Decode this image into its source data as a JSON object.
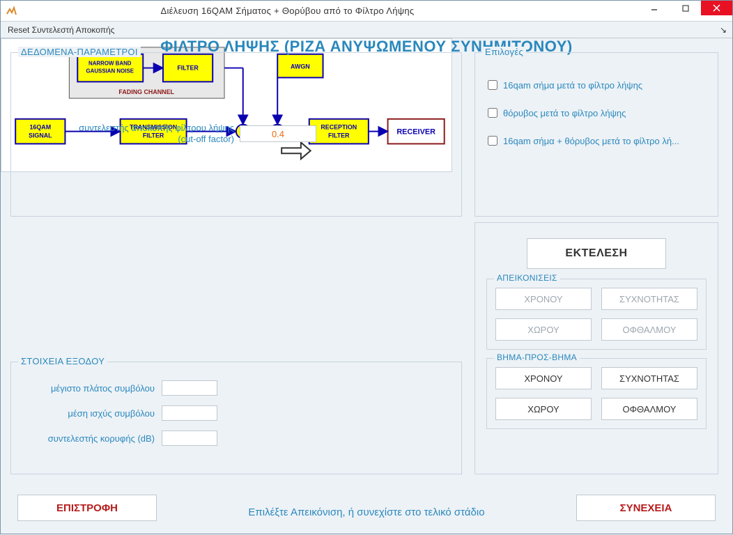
{
  "window": {
    "title": "Διέλευση 16QAM Σήματος + Θορύβου από το Φίλτρο Λήψης"
  },
  "menubar": {
    "reset": "Reset Συντελεστή Αποκοπής"
  },
  "main_title": "ΦΙΛΤΡΟ ΛΗΨΗΣ (ΡΙΖΑ ΑΝΥΨΩΜΕΝΟΥ ΣΥΝΗΜΙΤΟΝΟΥ)",
  "params": {
    "legend": "ΔΕΔΟΜΕΝΑ-ΠΑΡΑΜΕΤΡΟΙ",
    "cutoff_label_line1": "συντελεστής αποκοπής φίλτρου λήψης",
    "cutoff_label_line2": "(cut-off factor)",
    "cutoff_value": "0.4"
  },
  "options": {
    "legend": "Επιλογές",
    "items": [
      "16qam σήμα μετά το φίλτρο λήψης",
      "θόρυβος μετά το φίλτρο λήψης",
      "16qam σήμα + θόρυβος μετά το φίλτρο λή..."
    ]
  },
  "diagram": {
    "blocks": {
      "nbg_noise_l1": "NARROW BAND",
      "nbg_noise_l2": "GAUSSIAN NOISE",
      "filter": "FILTER",
      "fading_label": "FADING CHANNEL",
      "awgn": "AWGN",
      "qam_l1": "16QAM",
      "qam_l2": "SIGNAL",
      "tx_l1": "TRANSMISSION",
      "tx_l2": "FILTER",
      "rx_l1": "RECEPTION",
      "rx_l2": "FILTER",
      "receiver": "RECEIVER",
      "mult": "x",
      "adder": "+"
    }
  },
  "outputs": {
    "legend": "ΣΤΟΙΧΕΙΑ ΕΞΟΔΟΥ",
    "rows": [
      "μέγιστο πλάτος συμβόλου",
      "μέση ισχύς συμβόλου",
      "συντελεστής κορυφής (dB)"
    ]
  },
  "actions": {
    "execute": "ΕΚΤΕΛΕΣΗ",
    "views": {
      "legend": "ΑΠΕΙΚΟΝΙΣΕΙΣ",
      "btns": [
        "ΧΡΟΝΟΥ",
        "ΣΥΧΝΟΤΗΤΑΣ",
        "ΧΩΡΟΥ",
        "ΟΦΘΑΛΜΟΥ"
      ]
    },
    "steps": {
      "legend": "ΒΗΜΑ-ΠΡΟΣ-ΒΗΜΑ",
      "btns": [
        "ΧΡΟΝΟΥ",
        "ΣΥΧΝΟΤΗΤΑΣ",
        "ΧΩΡΟΥ",
        "ΟΦΘΑΛΜΟΥ"
      ]
    }
  },
  "bottom": {
    "back": "ΕΠΙΣΤΡΟΦΗ",
    "continue": "ΣΥΝΕΧΕΙΑ",
    "hint": "Επιλέξτε Απεικόνιση, ή συνεχίστε στο τελικό στάδιο"
  }
}
